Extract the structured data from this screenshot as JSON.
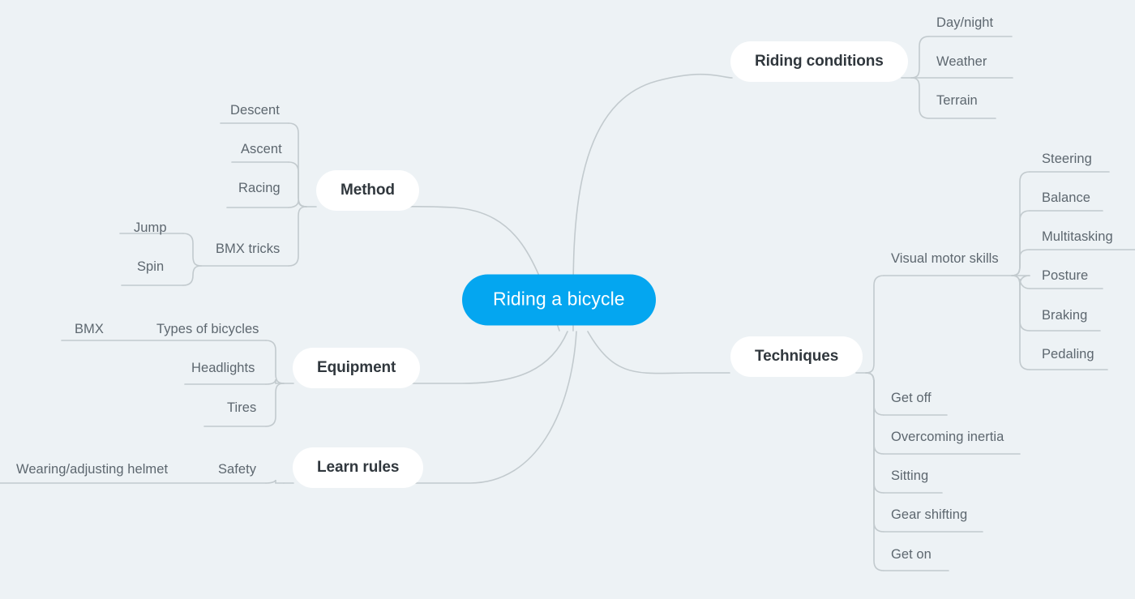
{
  "diagram": {
    "type": "mind-map",
    "title": "Riding a bicycle",
    "background_color": "#edf2f5",
    "hub_color": "#04a6f0",
    "hub_text_color": "#ffffff",
    "branch_node_color": "#ffffff",
    "branch_text_color": "#30373d",
    "leaf_text_color": "#5d676f",
    "connector_color": "#c2cace"
  },
  "root": {
    "label": "Riding a bicycle"
  },
  "branches": {
    "riding_conditions": {
      "label": "Riding conditions",
      "side": "right",
      "children": [
        {
          "label": "Day/night"
        },
        {
          "label": "Weather"
        },
        {
          "label": "Terrain"
        }
      ]
    },
    "techniques": {
      "label": "Techniques",
      "side": "right",
      "children": [
        {
          "label": "Visual motor skills",
          "children": [
            {
              "label": "Steering"
            },
            {
              "label": "Balance"
            },
            {
              "label": "Multitasking"
            },
            {
              "label": "Posture"
            },
            {
              "label": "Braking"
            },
            {
              "label": "Pedaling"
            }
          ]
        },
        {
          "label": "Get off"
        },
        {
          "label": "Overcoming inertia"
        },
        {
          "label": "Sitting"
        },
        {
          "label": "Gear shifting"
        },
        {
          "label": "Get on"
        }
      ]
    },
    "method": {
      "label": "Method",
      "side": "left",
      "children": [
        {
          "label": "Descent"
        },
        {
          "label": "Ascent"
        },
        {
          "label": "Racing"
        },
        {
          "label": "BMX tricks",
          "children": [
            {
              "label": "Jump"
            },
            {
              "label": "Spin"
            }
          ]
        }
      ]
    },
    "equipment": {
      "label": "Equipment",
      "side": "left",
      "children": [
        {
          "label": "Types of bicycles",
          "children": [
            {
              "label": "BMX"
            }
          ]
        },
        {
          "label": "Headlights"
        },
        {
          "label": "Tires"
        }
      ]
    },
    "learn_rules": {
      "label": "Learn rules",
      "side": "left",
      "children": [
        {
          "label": "Safety",
          "children": [
            {
              "label": "Wearing/adjusting helmet"
            }
          ]
        }
      ]
    }
  }
}
